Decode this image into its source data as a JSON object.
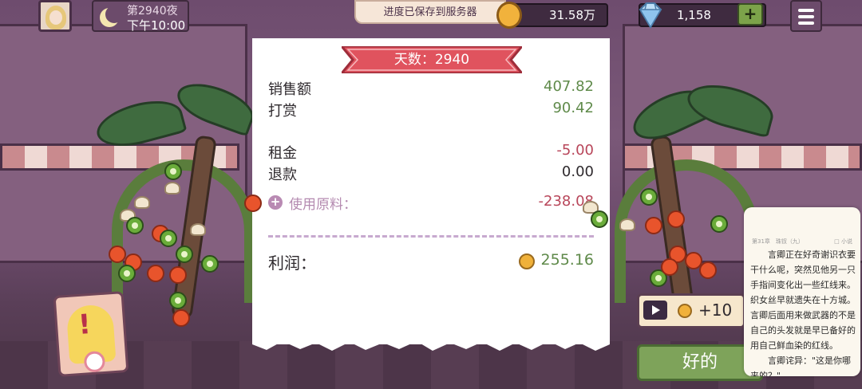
{
  "hud": {
    "night": "第2940夜",
    "time": "下午10:00",
    "save_notice": "进度已保存到服务器",
    "coins": "31.58万",
    "gems": "1,158",
    "plus": "+"
  },
  "receipt": {
    "day_banner": "天数：2940",
    "rows": [
      {
        "label": "销售额",
        "value": "407.82",
        "color": "#5f8a4a"
      },
      {
        "label": "打赏",
        "value": "90.42",
        "color": "#5f8a4a"
      },
      {
        "label": "租金",
        "value": "-5.00",
        "color": "#b8465a"
      },
      {
        "label": "退款",
        "value": "0.00",
        "color": "#2f2a2e"
      }
    ],
    "materials_label": "使用原料：",
    "materials_value": "-238.08",
    "profit_label": "利润：",
    "profit_value": "255.16"
  },
  "actions": {
    "ad_reward": "+10",
    "ok": "好的"
  },
  "novel": {
    "header_left": "第31章　珠钗（九）",
    "header_right": "□ 小说",
    "paragraphs": [
      "言卿正在好奇谢识衣要干什么呢，突然见他另一只手指间变化出一些红线来。织女丝早就遗失在十方城。言卿后面用来做武器的不是自己的头发就是早已备好的用自己鲜血染的红线。",
      "言卿诧异：\"这是你哪来的？\""
    ]
  },
  "icons": {
    "moon": "moon-icon",
    "coin": "coin-icon",
    "gem": "diamond-icon",
    "menu": "hamburger-menu-icon",
    "play": "video-play-icon",
    "alert": "exclamation-icon",
    "materials": "plus-circle-icon"
  }
}
